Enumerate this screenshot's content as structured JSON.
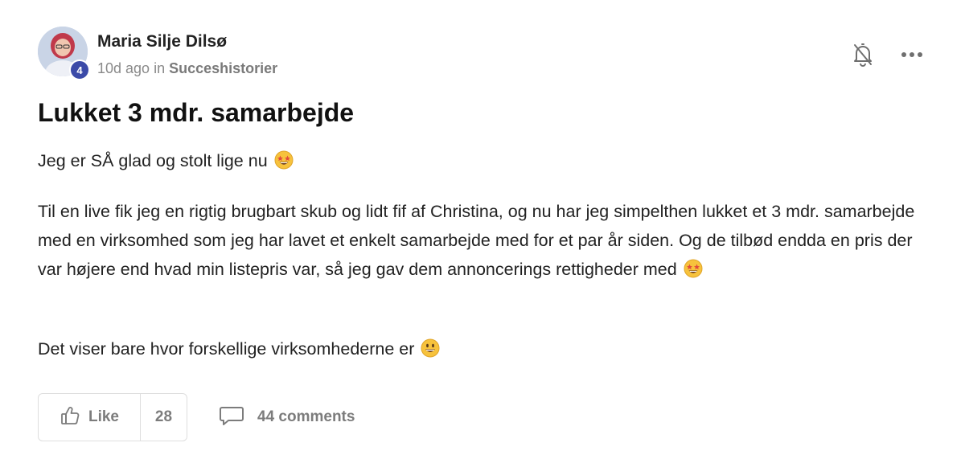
{
  "post": {
    "author": {
      "name": "Maria Silje Dilsø",
      "level": "4"
    },
    "meta": {
      "time": "10d ago",
      "in_word": "in",
      "category": "Succeshistorier"
    },
    "title": "Lukket 3 mdr. samarbejde",
    "paragraphs": [
      "Jeg er SÅ glad og stolt lige nu",
      "Til en live fik jeg en rigtig brugbart skub og lidt fif af Christina, og nu har jeg simpelthen lukket et 3 mdr. samarbejde med en virksomhed som jeg har lavet et enkelt samarbejde med for et par år siden. Og de tilbød endda en pris der var højere end hvad min listepris var, så jeg gav dem annoncerings rettigheder med",
      "Det viser bare hvor forskellige virksomhederne er"
    ],
    "emojis": [
      "star-struck-emoji",
      "star-struck-emoji",
      "grinning-emoji"
    ]
  },
  "actions": {
    "like_label": "Like",
    "like_count": "28",
    "comments_label": "44 comments"
  },
  "icons": {
    "bell": "bell-off-icon",
    "more": "more-horizontal-icon",
    "like": "thumbs-up-icon",
    "comments": "comment-bubble-icon"
  },
  "colors": {
    "level_badge": "#3b4aa8",
    "muted_text": "#7c7c7c",
    "emoji_yellow": "#f7c23c"
  }
}
